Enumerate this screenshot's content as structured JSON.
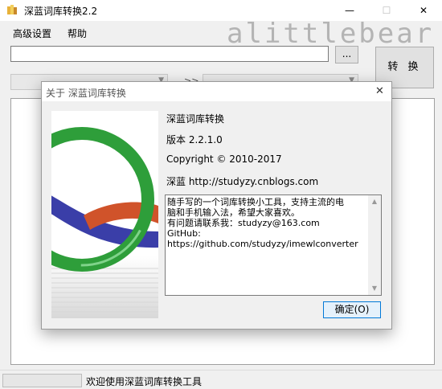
{
  "window": {
    "title": "深蓝词库转换2.2",
    "minimize_glyph": "—",
    "maximize_glyph": "☐",
    "close_glyph": "✕"
  },
  "watermark": "alittlebear",
  "menu": {
    "items": [
      {
        "label": "高级设置"
      },
      {
        "label": "帮助"
      }
    ]
  },
  "toolbar": {
    "path_value": "",
    "browse_label": "...",
    "convert_label": "转 换",
    "arrow_label": ">>"
  },
  "statusbar": {
    "text": "欢迎使用深蓝词库转换工具"
  },
  "about_dialog": {
    "title": "关于 深蓝词库转换",
    "close_glyph": "✕",
    "product_name": "深蓝词库转换",
    "version": "版本 2.2.1.0",
    "copyright": "Copyright ©  2010-2017",
    "website": "深蓝 http://studyzy.cnblogs.com",
    "description": "随手写的一个词库转换小工具，支持主流的电\n脑和手机输入法，希望大家喜欢。\n有问题请联系我：studyzy@163.com\nGitHub: https://github.com/studyzy/imewlconverter",
    "ok_label": "确定(O)"
  },
  "colors": {
    "ring_green": "#2e9e3a",
    "ring_red": "#d0532a",
    "ring_blue": "#3a3ea8",
    "accent_border": "#0078d7"
  },
  "icons": {
    "app": "app-icon",
    "scroll_up": "chevron-up-icon",
    "scroll_down": "chevron-down-icon"
  }
}
